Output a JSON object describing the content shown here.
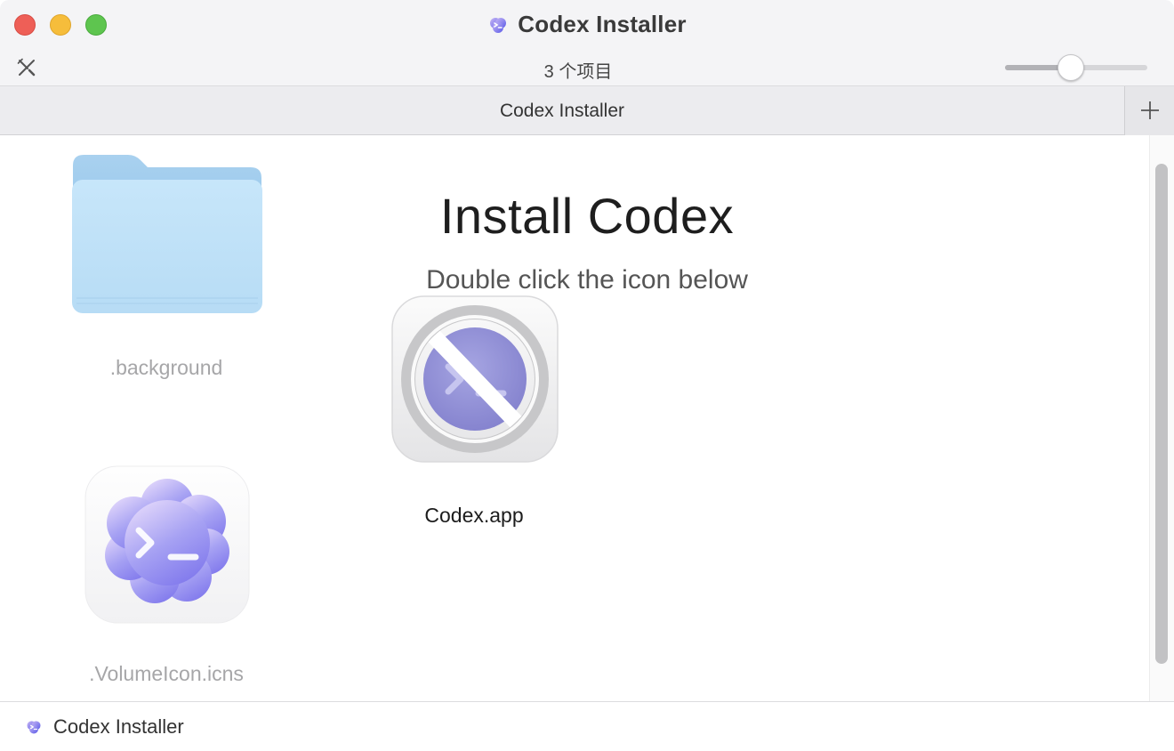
{
  "window": {
    "title": "Codex Installer",
    "title_icon": "codex-cloud-icon"
  },
  "toolbar": {
    "item_count": "3 个项目",
    "tool_icon": "tools-icon",
    "icon_size_slider_value": 0.46
  },
  "tabs": [
    {
      "label": "Codex Installer",
      "active": true
    }
  ],
  "tab_add_icon": "plus-icon",
  "content": {
    "background_title": "Install Codex",
    "background_subtitle": "Double click the icon below",
    "files": [
      {
        "name": ".background",
        "kind": "folder",
        "icon": "folder-icon",
        "hidden": true
      },
      {
        "name": "Codex.app",
        "kind": "application",
        "icon": "blocked-app-icon",
        "hidden": false
      },
      {
        "name": ".VolumeIcon.icns",
        "kind": "icon-file",
        "icon": "codex-cloud-icon",
        "hidden": true
      }
    ]
  },
  "pathbar": {
    "location": "Codex Installer",
    "icon": "codex-cloud-icon"
  },
  "colors": {
    "close": "#ee5f57",
    "minimize": "#f6bd3b",
    "maximize": "#5ec54f",
    "folder_blue": "#bfe2f8",
    "codex_purple": "#8a86ee"
  }
}
